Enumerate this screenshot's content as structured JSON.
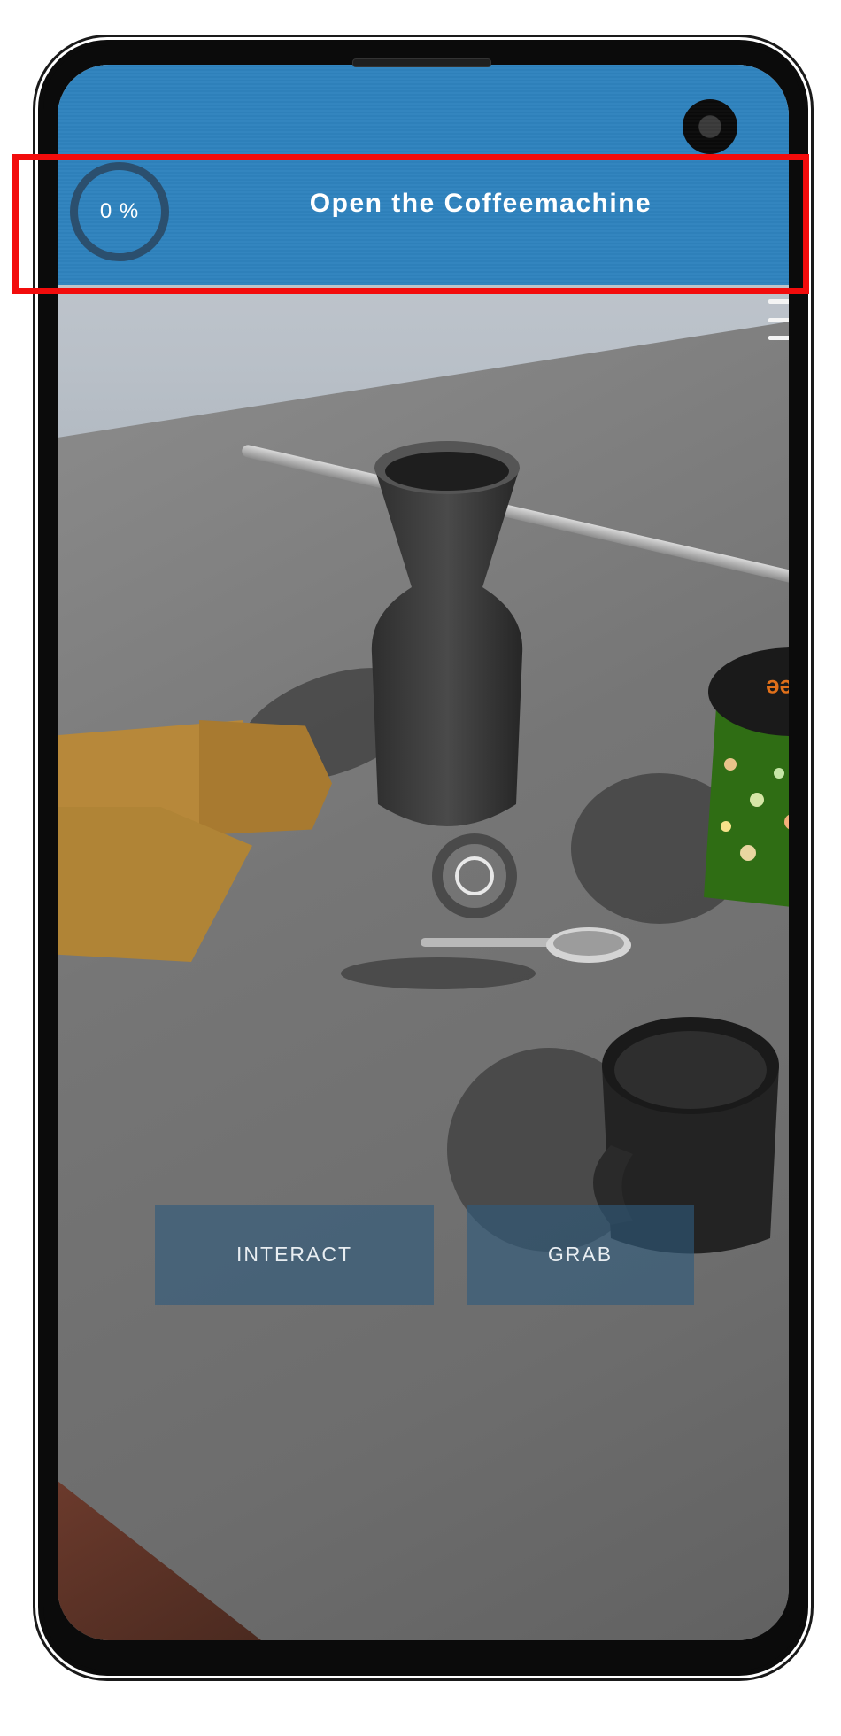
{
  "header": {
    "progress_text": "0 %",
    "progress_value": 0,
    "task_title": "Open the Coffeemachine"
  },
  "tin": {
    "label": "ffee"
  },
  "actions": {
    "interact_label": "INTERACT",
    "grab_label": "GRAB"
  },
  "icons": {
    "menu": "hamburger-menu-icon",
    "crosshair": "ar-crosshair-icon",
    "camera": "front-camera"
  },
  "colors": {
    "header_bg": "#2f83be",
    "progress_ring": "#2b4f6e",
    "highlight": "#f20c0c",
    "button_bg": "#2f5a7d"
  }
}
